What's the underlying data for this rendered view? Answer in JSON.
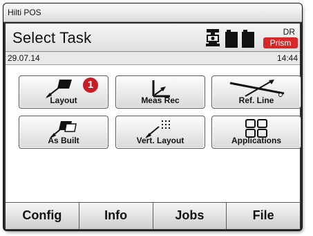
{
  "window": {
    "title": "Hilti POS"
  },
  "header": {
    "title": "Select Task",
    "status_icons": [
      "instrument-icon",
      "battery-icon"
    ],
    "mode_label": "DR",
    "mode_badge": "Prism",
    "badge_color": "#d62828"
  },
  "info_bar": {
    "date": "29.07.14",
    "time": "14:44"
  },
  "tiles": [
    {
      "label": "Layout",
      "icon": "layout-icon",
      "marker": "1"
    },
    {
      "label": "Meas Rec",
      "icon": "meas-rec-icon"
    },
    {
      "label": "Ref. Line",
      "icon": "ref-line-icon"
    },
    {
      "label": "As Built",
      "icon": "as-built-icon"
    },
    {
      "label": "Vert. Layout",
      "icon": "vert-layout-icon"
    },
    {
      "label": "Applications",
      "icon": "applications-icon"
    }
  ],
  "bottom_bar": [
    "Config",
    "Info",
    "Jobs",
    "File"
  ],
  "colors": {
    "marker": "#c81d25"
  }
}
